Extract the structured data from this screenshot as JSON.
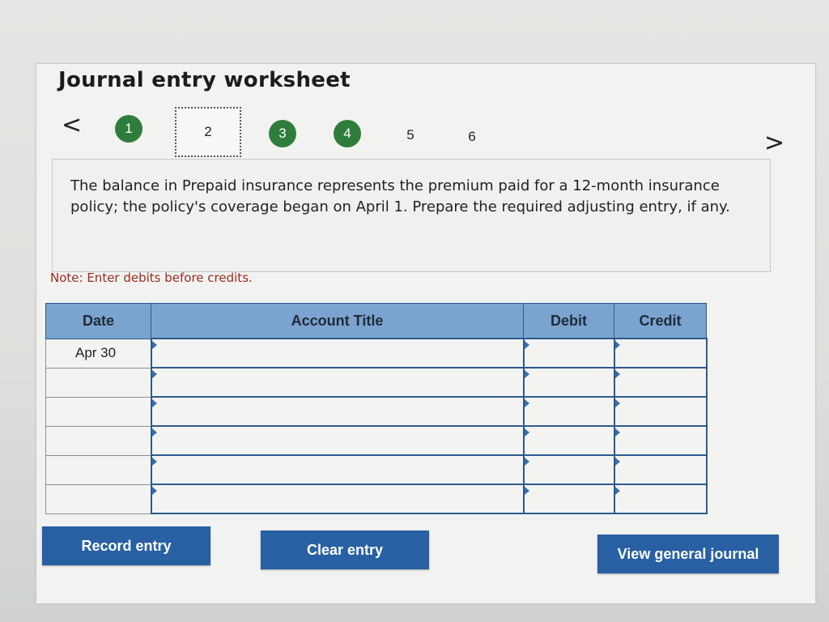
{
  "worksheet": {
    "title": "Journal entry worksheet",
    "nav": {
      "prev_icon": "chevron-left-icon",
      "next_icon": "chevron-right-icon",
      "prev_glyph": "<",
      "next_glyph": ">"
    },
    "steps": [
      {
        "label": "1",
        "state": "done"
      },
      {
        "label": "2",
        "state": "current"
      },
      {
        "label": "3",
        "state": "done"
      },
      {
        "label": "4",
        "state": "done"
      },
      {
        "label": "5",
        "state": "plain"
      },
      {
        "label": "6",
        "state": "plain"
      }
    ],
    "question": "The balance in Prepaid insurance represents the premium paid for a 12-month insurance policy; the policy's coverage began on April 1. Prepare the required adjusting entry, if any.",
    "note": "Note: Enter debits before credits."
  },
  "table": {
    "headers": {
      "date": "Date",
      "account": "Account Title",
      "debit": "Debit",
      "credit": "Credit"
    },
    "rows": [
      {
        "date": "Apr 30",
        "account": "",
        "debit": "",
        "credit": ""
      },
      {
        "date": "",
        "account": "",
        "debit": "",
        "credit": ""
      },
      {
        "date": "",
        "account": "",
        "debit": "",
        "credit": ""
      },
      {
        "date": "",
        "account": "",
        "debit": "",
        "credit": ""
      },
      {
        "date": "",
        "account": "",
        "debit": "",
        "credit": ""
      },
      {
        "date": "",
        "account": "",
        "debit": "",
        "credit": ""
      }
    ]
  },
  "buttons": {
    "record": "Record entry",
    "clear": "Clear entry",
    "view": "View general journal"
  },
  "colors": {
    "step_done": "#2f7d3a",
    "header_bg": "#7aa3cf",
    "button_bg": "#2860a3",
    "note_text": "#9b2a1e"
  }
}
